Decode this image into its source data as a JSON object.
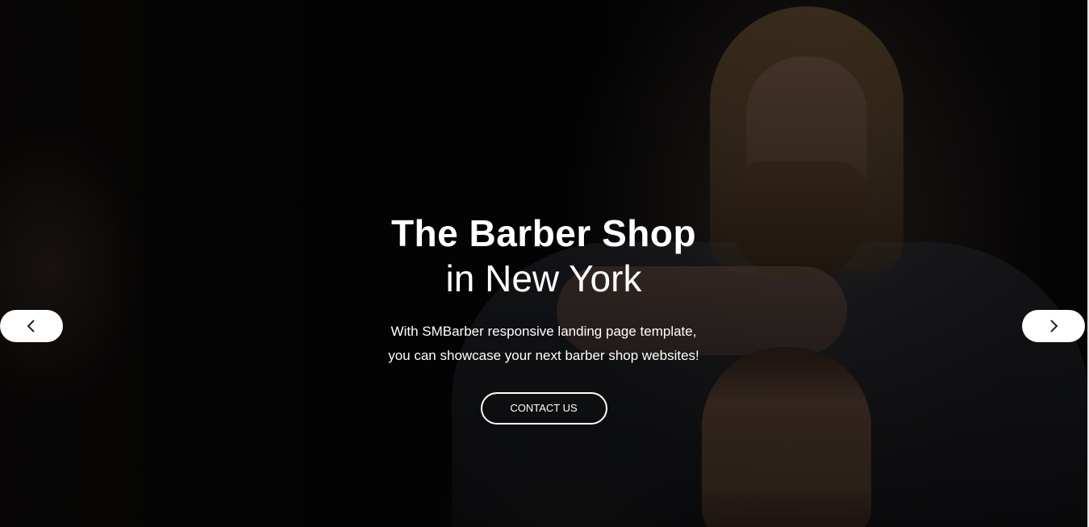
{
  "hero": {
    "title": "The Barber Shop",
    "subtitle": "in New York",
    "description_line1": "With SMBarber responsive landing page template,",
    "description_line2": "you can showcase your next barber shop websites!",
    "cta_label": "CONTACT US"
  },
  "slider": {
    "prev_icon": "chevron-left-icon",
    "next_icon": "chevron-right-icon"
  },
  "colors": {
    "text": "#ffffff",
    "button_bg": "#ffffff",
    "background": "#050505"
  }
}
